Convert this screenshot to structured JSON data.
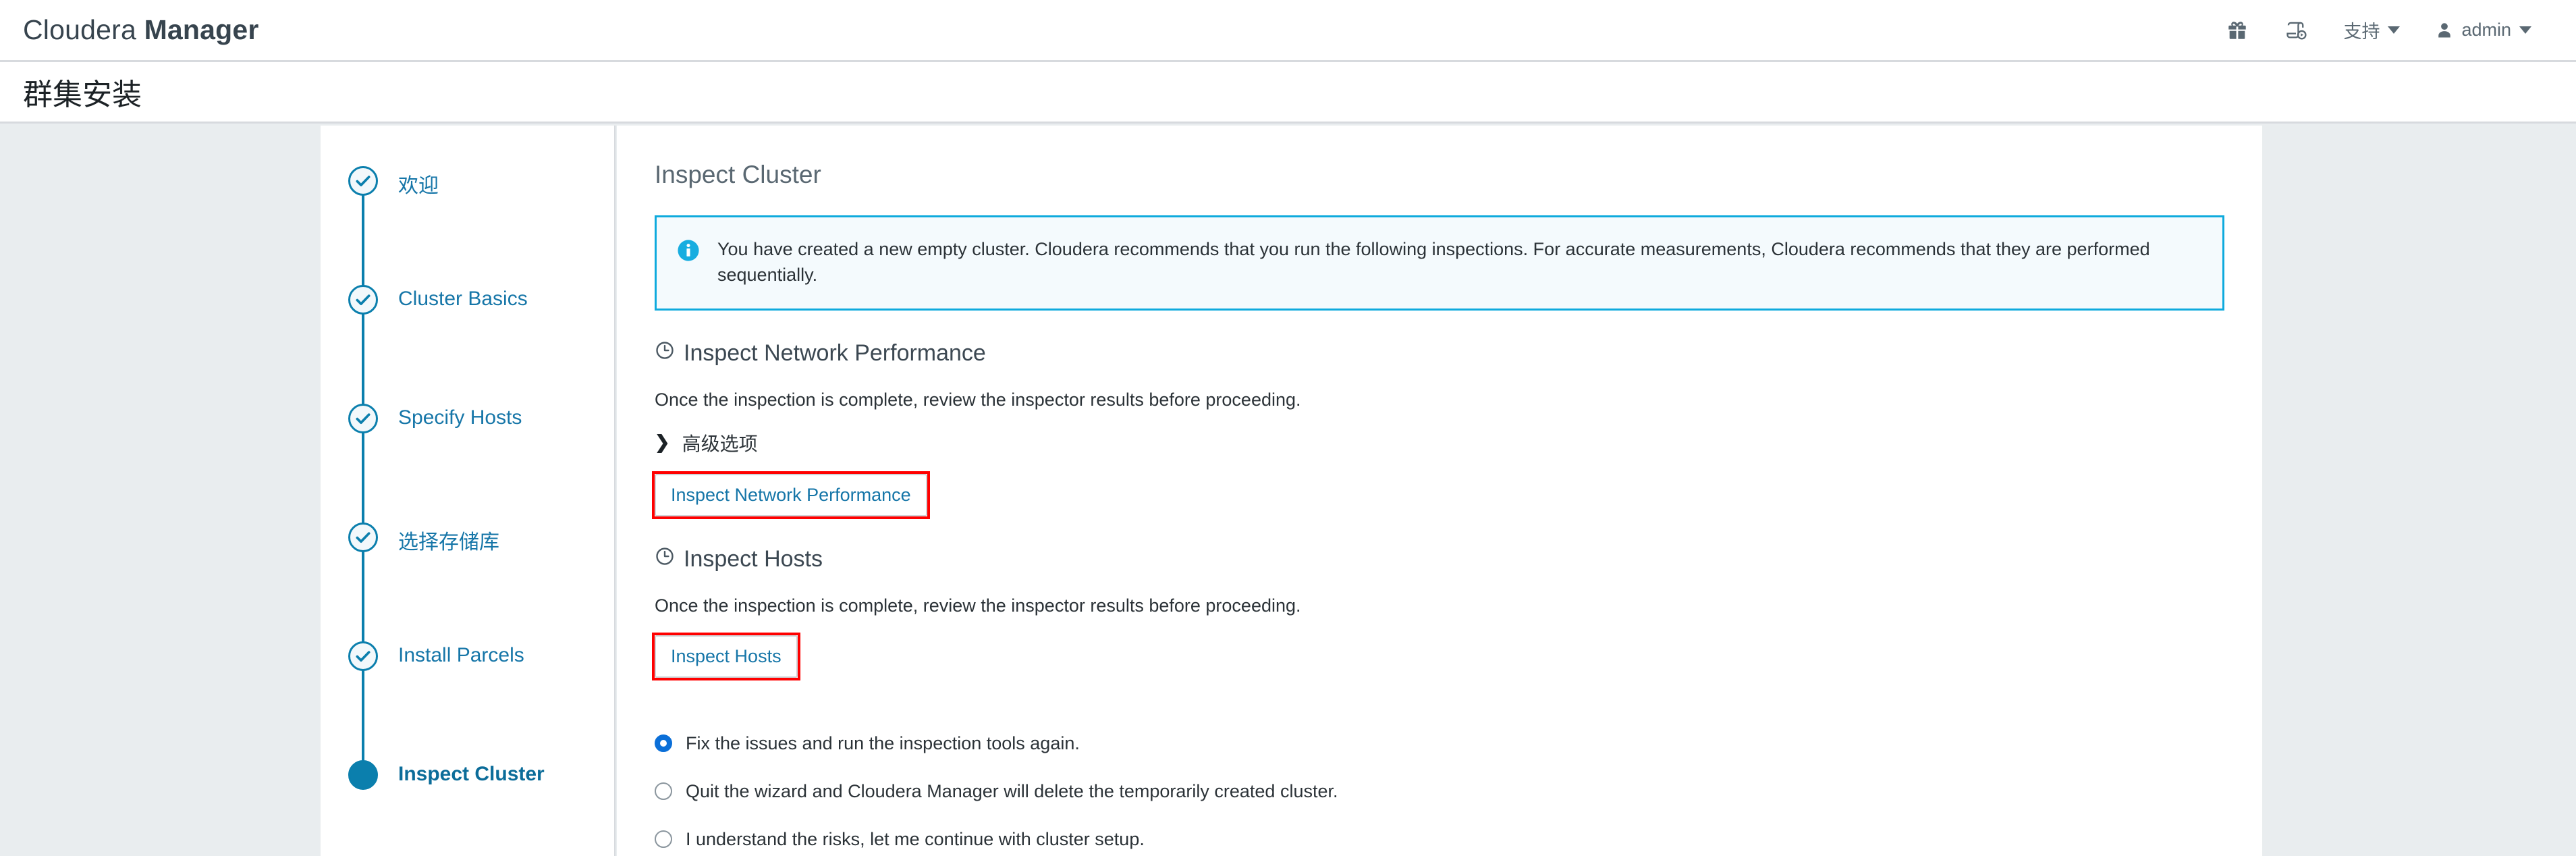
{
  "navbar": {
    "brand_light": "Cloudera ",
    "brand_bold": "Manager",
    "icons": {
      "gift": "gift-icon",
      "log": "parcel-log-icon",
      "user": "user-icon"
    },
    "support_label": "支持",
    "user_label": "admin"
  },
  "page": {
    "title": "群集安装"
  },
  "sidebar": {
    "steps": [
      {
        "label": "欢迎",
        "state": "done"
      },
      {
        "label": "Cluster Basics",
        "state": "done"
      },
      {
        "label": "Specify Hosts",
        "state": "done"
      },
      {
        "label": "选择存储库",
        "state": "done"
      },
      {
        "label": "Install Parcels",
        "state": "done"
      },
      {
        "label": "Inspect Cluster",
        "state": "active"
      }
    ]
  },
  "main": {
    "heading": "Inspect Cluster",
    "alert": {
      "icon": "info-circle-icon",
      "text": "You have created a new empty cluster. Cloudera recommends that you run the following inspections. For accurate measurements, Cloudera recommends that they are performed sequentially."
    },
    "network_section": {
      "icon": "clock-icon",
      "heading": "Inspect Network Performance",
      "description": "Once the inspection is complete, review the inspector results before proceeding.",
      "advanced_toggle": "高级选项",
      "advanced_chevron": "❯",
      "button_label": "Inspect Network Performance"
    },
    "hosts_section": {
      "icon": "clock-icon",
      "heading": "Inspect Hosts",
      "description": "Once the inspection is complete, review the inspector results before proceeding.",
      "button_label": "Inspect Hosts"
    },
    "radio_options": [
      {
        "label": "Fix the issues and run the inspection tools again.",
        "selected": true
      },
      {
        "label": "Quit the wizard and Cloudera Manager will delete the temporarily created cluster.",
        "selected": false
      },
      {
        "label": "I understand the risks, let me continue with cluster setup.",
        "selected": false
      }
    ]
  },
  "colors": {
    "brand_dark": "#37444e",
    "link_blue": "#1676a8",
    "step_blue": "#0b7fad",
    "info_cyan": "#0eaadd",
    "annotation_red": "#ff0000",
    "page_bg": "#e9edef"
  }
}
